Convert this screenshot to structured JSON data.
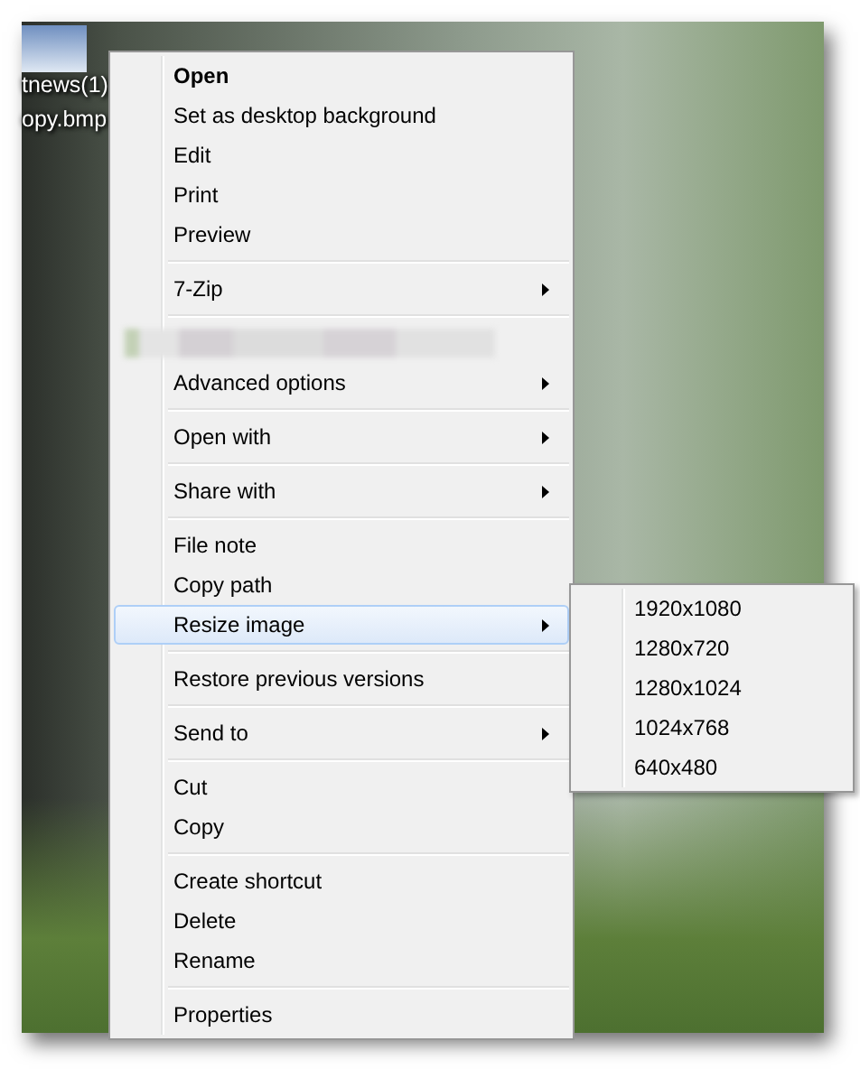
{
  "desktop_icon": {
    "label_lines": [
      "tnews(1)",
      "opy.bmp"
    ]
  },
  "context_menu": {
    "items": [
      {
        "kind": "item",
        "label": "Open",
        "default": true,
        "has_submenu": false,
        "selected": false
      },
      {
        "kind": "item",
        "label": "Set as desktop background",
        "default": false,
        "has_submenu": false,
        "selected": false
      },
      {
        "kind": "item",
        "label": "Edit",
        "default": false,
        "has_submenu": false,
        "selected": false
      },
      {
        "kind": "item",
        "label": "Print",
        "default": false,
        "has_submenu": false,
        "selected": false
      },
      {
        "kind": "item",
        "label": "Preview",
        "default": false,
        "has_submenu": false,
        "selected": false
      },
      {
        "kind": "separator"
      },
      {
        "kind": "item",
        "label": "7-Zip",
        "default": false,
        "has_submenu": true,
        "selected": false
      },
      {
        "kind": "separator"
      },
      {
        "kind": "blurred"
      },
      {
        "kind": "item",
        "label": "Advanced options",
        "default": false,
        "has_submenu": true,
        "selected": false
      },
      {
        "kind": "separator"
      },
      {
        "kind": "item",
        "label": "Open with",
        "default": false,
        "has_submenu": true,
        "selected": false
      },
      {
        "kind": "separator"
      },
      {
        "kind": "item",
        "label": "Share with",
        "default": false,
        "has_submenu": true,
        "selected": false
      },
      {
        "kind": "separator"
      },
      {
        "kind": "item",
        "label": "File note",
        "default": false,
        "has_submenu": false,
        "selected": false
      },
      {
        "kind": "item",
        "label": "Copy path",
        "default": false,
        "has_submenu": false,
        "selected": false
      },
      {
        "kind": "item",
        "label": "Resize image",
        "default": false,
        "has_submenu": true,
        "selected": true
      },
      {
        "kind": "separator"
      },
      {
        "kind": "item",
        "label": "Restore previous versions",
        "default": false,
        "has_submenu": false,
        "selected": false
      },
      {
        "kind": "separator"
      },
      {
        "kind": "item",
        "label": "Send to",
        "default": false,
        "has_submenu": true,
        "selected": false
      },
      {
        "kind": "separator"
      },
      {
        "kind": "item",
        "label": "Cut",
        "default": false,
        "has_submenu": false,
        "selected": false
      },
      {
        "kind": "item",
        "label": "Copy",
        "default": false,
        "has_submenu": false,
        "selected": false
      },
      {
        "kind": "separator"
      },
      {
        "kind": "item",
        "label": "Create shortcut",
        "default": false,
        "has_submenu": false,
        "selected": false
      },
      {
        "kind": "item",
        "label": "Delete",
        "default": false,
        "has_submenu": false,
        "selected": false
      },
      {
        "kind": "item",
        "label": "Rename",
        "default": false,
        "has_submenu": false,
        "selected": false
      },
      {
        "kind": "separator"
      },
      {
        "kind": "item",
        "label": "Properties",
        "default": false,
        "has_submenu": false,
        "selected": false
      }
    ]
  },
  "submenu": {
    "items": [
      "1920x1080",
      "1280x720",
      "1280x1024",
      "1024x768",
      "640x480"
    ]
  }
}
